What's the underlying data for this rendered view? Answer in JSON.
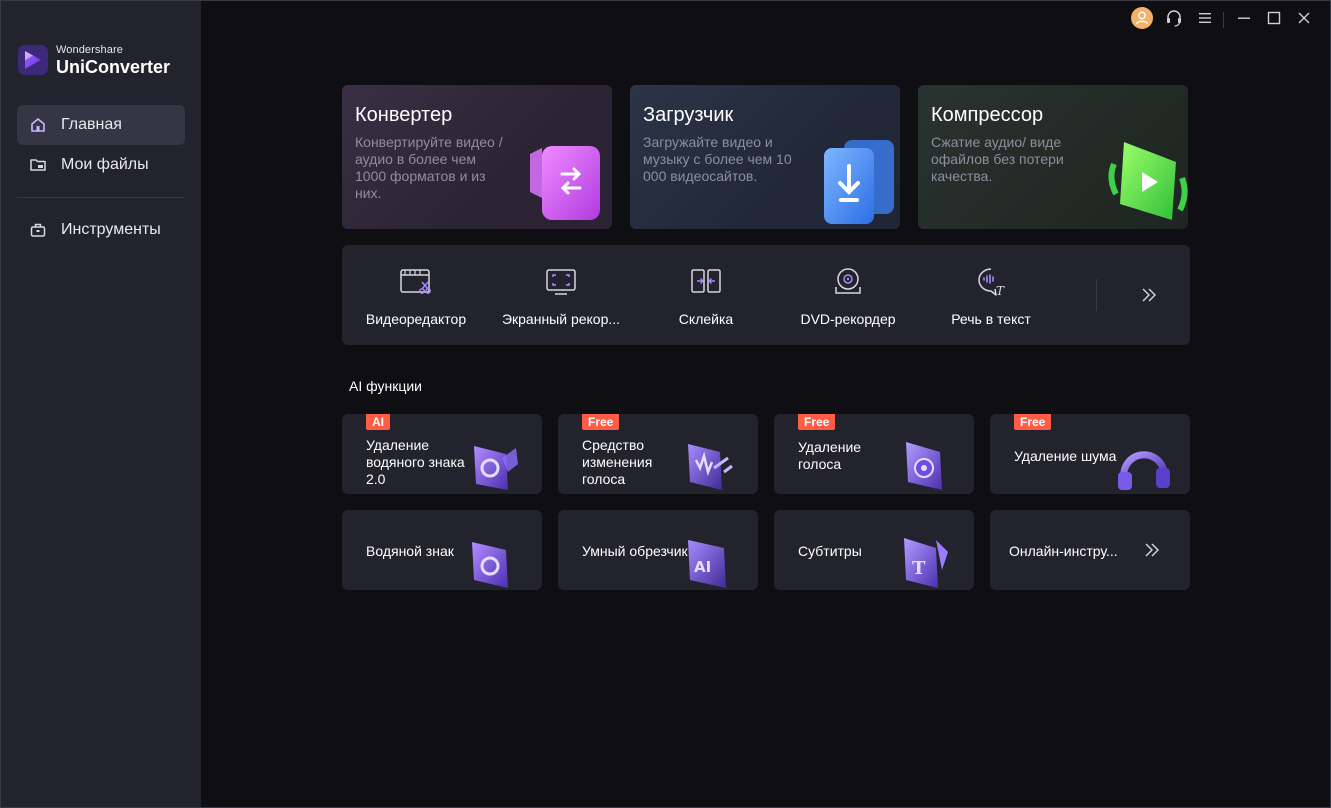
{
  "app": {
    "brand": "Wondershare",
    "product": "UniConverter"
  },
  "sidebar": {
    "items": [
      {
        "label": "Главная",
        "icon": "home-icon",
        "active": true
      },
      {
        "label": "Мои файлы",
        "icon": "folder-icon",
        "active": false
      },
      {
        "label": "Инструменты",
        "icon": "toolbox-icon",
        "active": false
      }
    ]
  },
  "titlebar": {
    "buttons": [
      "avatar-icon",
      "headset-icon",
      "menu-icon",
      "minimize-icon",
      "maximize-icon",
      "close-icon"
    ]
  },
  "cards": [
    {
      "title": "Конвертер",
      "desc": "Конвертируйте видео / аудио в более чем 1000 форматов и из них."
    },
    {
      "title": "Загрузчик",
      "desc": "Загружайте видео и музыку с более чем 10 000 видеосайтов."
    },
    {
      "title": "Компрессор",
      "desc": "Сжатие аудио/ виде офайлов без потери качества."
    }
  ],
  "tools": [
    {
      "label": "Видеоредактор",
      "icon": "video-editor-icon"
    },
    {
      "label": "Экранный рекор...",
      "icon": "screen-recorder-icon"
    },
    {
      "label": "Склейка",
      "icon": "merge-icon"
    },
    {
      "label": "DVD-рекордер",
      "icon": "dvd-recorder-icon"
    },
    {
      "label": "Речь в текст",
      "icon": "speech-to-text-icon"
    }
  ],
  "ai_section": {
    "title": "AI функции",
    "cards": [
      {
        "label": "Удаление водяного знака 2.0",
        "badge": "AI"
      },
      {
        "label": "Средство изменения голоса",
        "badge": "Free"
      },
      {
        "label": "Удаление голоса",
        "badge": "Free"
      },
      {
        "label": "Удаление шума",
        "badge": "Free"
      },
      {
        "label": "Водяной знак",
        "badge": ""
      },
      {
        "label": "Умный обрезчик",
        "badge": ""
      },
      {
        "label": "Субтитры",
        "badge": ""
      },
      {
        "label": "Онлайн-инстру...",
        "badge": ""
      }
    ]
  },
  "colors": {
    "accent": "#7b4dff",
    "badge": "#ff5b45",
    "sidebar_bg": "#23232d",
    "card_bg": "#23232d"
  }
}
